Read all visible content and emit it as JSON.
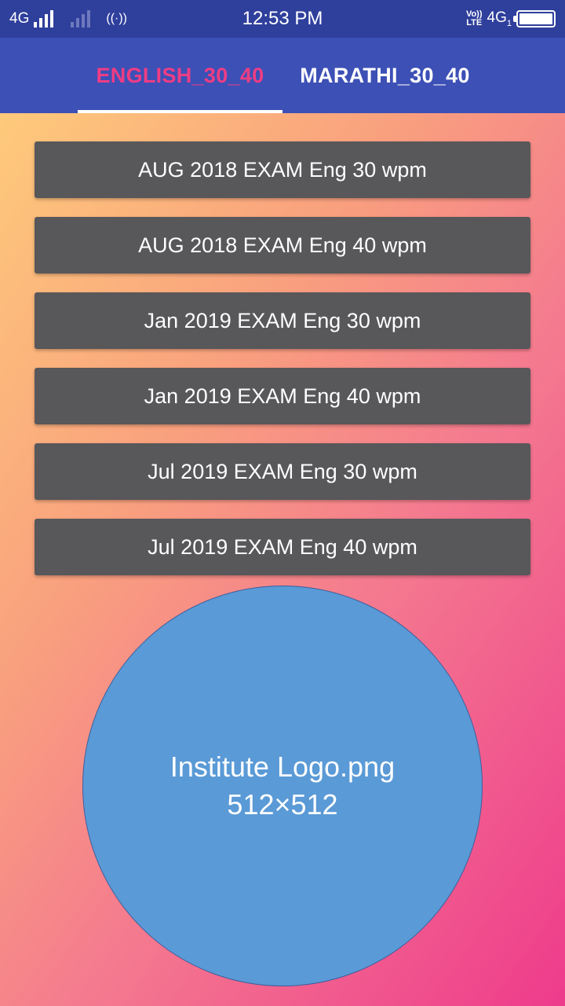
{
  "status_bar": {
    "network_left": "4G",
    "time": "12:53 PM",
    "volte_top": "Vo))",
    "volte_bottom": "LTE",
    "network_right": "4G",
    "sim_index": "1"
  },
  "tabs": [
    {
      "label": "ENGLISH_30_40",
      "selected": true
    },
    {
      "label": "MARATHI_30_40",
      "selected": false
    }
  ],
  "exams": [
    {
      "label": "AUG 2018 EXAM Eng 30 wpm"
    },
    {
      "label": "AUG 2018 EXAM Eng 40 wpm"
    },
    {
      "label": "Jan 2019 EXAM Eng 30 wpm"
    },
    {
      "label": "Jan 2019 EXAM Eng 40 wpm"
    },
    {
      "label": "Jul 2019 EXAM Eng 30 wpm"
    },
    {
      "label": "Jul 2019 EXAM Eng 40 wpm"
    }
  ],
  "logo": {
    "line1": "Institute Logo.png",
    "line2": "512×512"
  },
  "colors": {
    "status_bar": "#2f3f9c",
    "tab_bar": "#3d50b6",
    "tab_selected_text": "#ee3d84",
    "exam_button": "#58575a",
    "logo_fill": "#5a9ad6"
  }
}
